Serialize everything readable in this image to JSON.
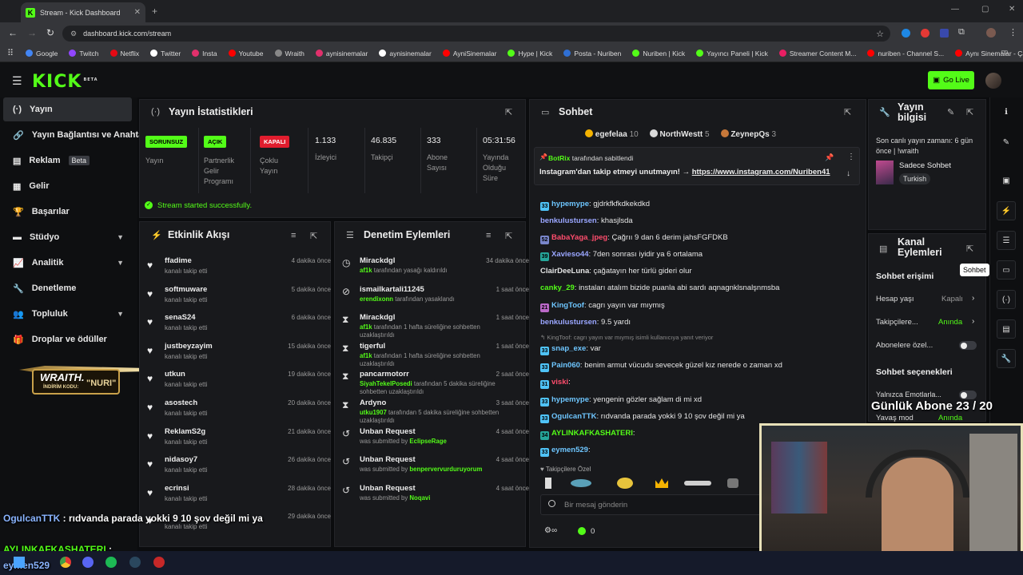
{
  "browser": {
    "tab_title": "Stream - Kick Dashboard",
    "url": "dashboard.kick.com/stream",
    "bookmarks": [
      "Google",
      "Twitch",
      "Netflix",
      "Twitter",
      "Insta",
      "Youtube",
      "Wraith",
      "aynisinemalar",
      "aynisinemalar",
      "AyniSinemalar",
      "Hype | Kick",
      "Posta - Nuriben",
      "Nuriben | Kick",
      "Yayıncı Paneli | Kick",
      "Streamer Content M...",
      "nuriben - Channel S...",
      "Aynı Sinemalar - Ça..."
    ]
  },
  "header": {
    "logo": "KICK",
    "logo_beta": "BETA",
    "go_live": "Go Live"
  },
  "sidebar": {
    "items": [
      {
        "label": "Yayın"
      },
      {
        "label": "Yayın Bağlantısı ve Anahtar"
      },
      {
        "label": "Reklam",
        "badge": "Beta"
      },
      {
        "label": "Gelir"
      },
      {
        "label": "Başarılar"
      },
      {
        "label": "Stüdyo"
      },
      {
        "label": "Analitik"
      },
      {
        "label": "Denetleme"
      },
      {
        "label": "Topluluk"
      },
      {
        "label": "Droplar ve ödüller"
      }
    ],
    "promo": {
      "brand": "WRAITH.",
      "code_label": "İNDİRİM KODU:",
      "code": "NURI"
    }
  },
  "stats": {
    "title": "Yayın İstatistikleri",
    "tags": [
      {
        "badge": "SORUNSUZ",
        "label": "Yayın"
      },
      {
        "badge": "AÇIK",
        "label": "Partnerlik Gelir Programı"
      },
      {
        "badge": "KAPALI",
        "label": "Çoklu Yayın"
      }
    ],
    "values": [
      {
        "value": "1.133",
        "label": "İzleyici"
      },
      {
        "value": "46.835",
        "label": "Takipçi"
      },
      {
        "value": "333",
        "label": "Abone Sayısı"
      },
      {
        "value": "05:31:56",
        "label": "Yayında Olduğu Süre"
      }
    ],
    "status": "Stream started successfully."
  },
  "activity": {
    "title": "Etkinlik Akışı",
    "items": [
      {
        "name": "ffadime",
        "sub": "kanalı takip etti",
        "time": "4 dakika önce"
      },
      {
        "name": "softmuware",
        "sub": "kanalı takip etti",
        "time": "5 dakika önce"
      },
      {
        "name": "senaS24",
        "sub": "kanalı takip etti",
        "time": "6 dakika önce"
      },
      {
        "name": "justbeyzayim",
        "sub": "kanalı takip etti",
        "time": "15 dakika önce"
      },
      {
        "name": "utkun",
        "sub": "kanalı takip etti",
        "time": "19 dakika önce"
      },
      {
        "name": "asostech",
        "sub": "kanalı takip etti",
        "time": "20 dakika önce"
      },
      {
        "name": "ReklamS2g",
        "sub": "kanalı takip etti",
        "time": "21 dakika önce"
      },
      {
        "name": "nidasoy7",
        "sub": "kanalı takip etti",
        "time": "26 dakika önce"
      },
      {
        "name": "ecrinsi",
        "sub": "kanalı takip etti",
        "time": "28 dakika önce"
      },
      {
        "name": "",
        "sub": "kanalı takip etti",
        "time": "29 dakika önce"
      }
    ]
  },
  "moderation": {
    "title": "Denetim Eylemleri",
    "items": [
      {
        "name": "Mirackdgl",
        "actor": "af1k",
        "text": "tarafından yasağı kaldırıldı",
        "time": "34 dakika önce",
        "icon": "clock-icon"
      },
      {
        "name": "ismailkartali11245",
        "actor": "erendixonn",
        "text": "tarafından yasaklandı",
        "time": "1 saat önce",
        "icon": "ban-icon"
      },
      {
        "name": "Mirackdgl",
        "actor": "af1k",
        "text": "tarafından 1 hafta süreliğine sohbetten uzaklaştırıldı",
        "time": "1 saat önce",
        "icon": "hourglass-icon"
      },
      {
        "name": "tigerful",
        "actor": "af1k",
        "text": "tarafından 1 hafta süreliğine sohbetten uzaklaştırıldı",
        "time": "1 saat önce",
        "icon": "hourglass-icon"
      },
      {
        "name": "pancarmotorr",
        "actor": "SiyahTekelPosedi",
        "text": "tarafından 5 dakika süreliğine sohbetten uzaklaştırıldı",
        "time": "2 saat önce",
        "icon": "hourglass-icon"
      },
      {
        "name": "Ardyno",
        "actor": "utku1907",
        "text": "tarafından 5 dakika süreliğine sohbetten uzaklaştırıldı",
        "time": "3 saat önce",
        "icon": "hourglass-icon"
      },
      {
        "name": "Unban Request",
        "actor": "EclipseRage",
        "text": "was submitted by",
        "time": "4 saat önce",
        "icon": "undo-icon"
      },
      {
        "name": "Unban Request",
        "actor": "benpervervurduruyorum",
        "text": "was submitted by",
        "time": "4 saat önce",
        "icon": "undo-icon"
      },
      {
        "name": "Unban Request",
        "actor": "Noqavi",
        "text": "was submitted by",
        "time": "4 saat önce",
        "icon": "undo-icon"
      }
    ]
  },
  "chat": {
    "title": "Sohbet",
    "top_gifters": [
      {
        "name": "egefelaa",
        "count": "10"
      },
      {
        "name": "NorthWestt",
        "count": "5"
      },
      {
        "name": "ZeynepQs",
        "count": "3"
      }
    ],
    "pinned": {
      "by": "BotRix",
      "by_suffix": "tarafından sabitlendi",
      "text": "Instagram'dan takip etmeyi unutmayın! →",
      "link": "https://www.instagram.com/Nuriben41"
    },
    "messages": [
      {
        "user": "hypemype",
        "color": "#6ec6ff",
        "text": ": gjdrkfkfkdkekdkd",
        "badge": "33"
      },
      {
        "user": "benkulustursen",
        "color": "#9aa6ff",
        "text": ": khasjlsda"
      },
      {
        "user": "BabaYaga_jpeg",
        "color": "#ff4d6d",
        "text": ": Çağrıı 9 dan 6 derim jahsFGFDKB",
        "badge": "52"
      },
      {
        "user": "Xavieso44",
        "color": "#9aa6ff",
        "text": ": 7den sonrası iyidir ya 6 ortalama",
        "badge": "39"
      },
      {
        "user": "ClairDeeLuna",
        "color": "#e6e6e6",
        "text": ": çağatayın her türlü gideri olur"
      },
      {
        "user": "canky_29",
        "color": "#53fc18",
        "text": ": instaları atalım bizide puanla abi sardı aqnagnklsnalşnmsba"
      },
      {
        "user": "KingToof",
        "color": "#6ec6ff",
        "text": ": cagrı yayın var mıymış",
        "badge": "21"
      },
      {
        "user": "benkulustursen",
        "color": "#9aa6ff",
        "text": ": 9.5 yardı"
      },
      {
        "user": "snap_exe",
        "color": "#6ec6ff",
        "text": ": var",
        "badge": "33",
        "reply": "KingToof: cagrı yayın var mıymış isimli kullanıcıya yanıt veriyor"
      },
      {
        "user": "Pain060",
        "color": "#6ec6ff",
        "text": ": benim armut vücudu sevecek güzel kız nerede o zaman xd",
        "badge": "33"
      },
      {
        "user": "viski",
        "color": "#ff4d6d",
        "text": ":",
        "badge": "31"
      },
      {
        "user": "hypemype",
        "color": "#6ec6ff",
        "text": ": yengenin gözler sağlam di mi xd",
        "badge": "33"
      },
      {
        "user": "OgulcanTTK",
        "color": "#6ec6ff",
        "text": ": rıdvanda parada yokki 9 10 şov değil mi ya",
        "badge": "33"
      },
      {
        "user": "AYLINKAFKASHATERI",
        "color": "#53fc18",
        "text": ":",
        "badge": "34"
      },
      {
        "user": "eymen529",
        "color": "#6ec6ff",
        "text": ":",
        "badge": "33"
      }
    ],
    "followers_only": "Takipçilere Özel",
    "input_placeholder": "Bir mesaj gönderin",
    "points": "0"
  },
  "stream_info": {
    "title": "Yayın bilgisi",
    "last_live": "Son canlı yayın zamanı: 6 gün önce | !wraith",
    "category": "Sadece Sohbet",
    "language": "Turkish"
  },
  "channel_actions": {
    "title": "Kanal Eylemleri",
    "chat_access": "Sohbet erişimi",
    "slow_mode": {
      "label": "Hesap yaşı",
      "value": "Kapalı"
    },
    "followers": {
      "label": "Takipçilere...",
      "value": "Anında"
    },
    "subs": {
      "label": "Abonelere özel..."
    },
    "chat_options": "Sohbet seçenekleri",
    "emotes": {
      "label": "Yalnızca Emotlarla..."
    },
    "slow": {
      "label": "Yavaş mod",
      "value": "Anında"
    }
  },
  "tooltip": "Sohbet",
  "overlay": {
    "sub_goal": "Günlük Abone 23 / 20",
    "chat1_user": "OgulcanTTK",
    "chat1_text": " : rıdvanda parada yokki 9 10 şov değil mi ya",
    "chat2_user": "AYLINKAFKASHATERI",
    "chat2_text": " :",
    "chat3_user": "eymen529"
  },
  "colors": {
    "accent": "#53fc18",
    "danger": "#e11d2e",
    "panel": "#18191c"
  }
}
